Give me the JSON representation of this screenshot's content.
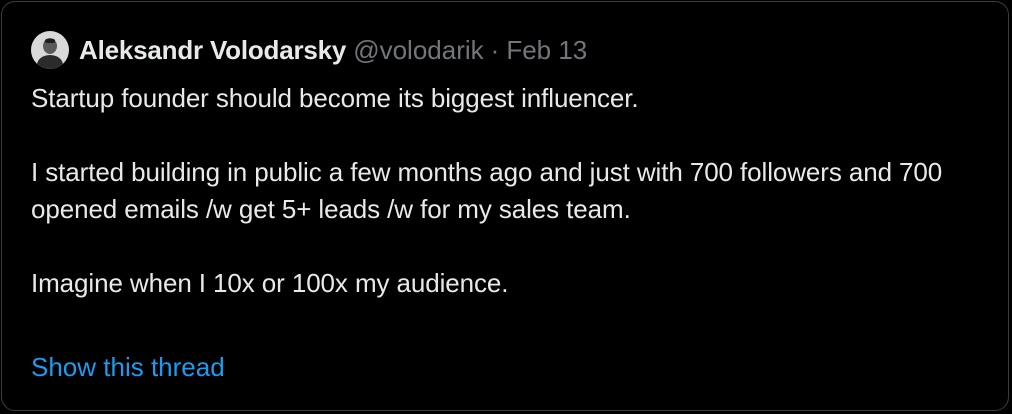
{
  "tweet": {
    "author": {
      "display_name": "Aleksandr Volodarsky",
      "handle": "@volodarik",
      "avatar_icon": "user-avatar-icon"
    },
    "separator": "·",
    "date": "Feb 13",
    "paragraphs": [
      "Startup founder should become its biggest influencer.",
      "I started building in public a few months ago and just with 700 followers and 700 opened emails /w get 5+ leads /w for my sales team.",
      "Imagine when I 10x or 100x my audience."
    ],
    "show_thread_label": "Show this thread"
  },
  "colors": {
    "background": "#000000",
    "border": "#3a3d40",
    "primary_text": "#e7e9ea",
    "secondary_text": "#71767b",
    "link": "#1d9bf0"
  }
}
